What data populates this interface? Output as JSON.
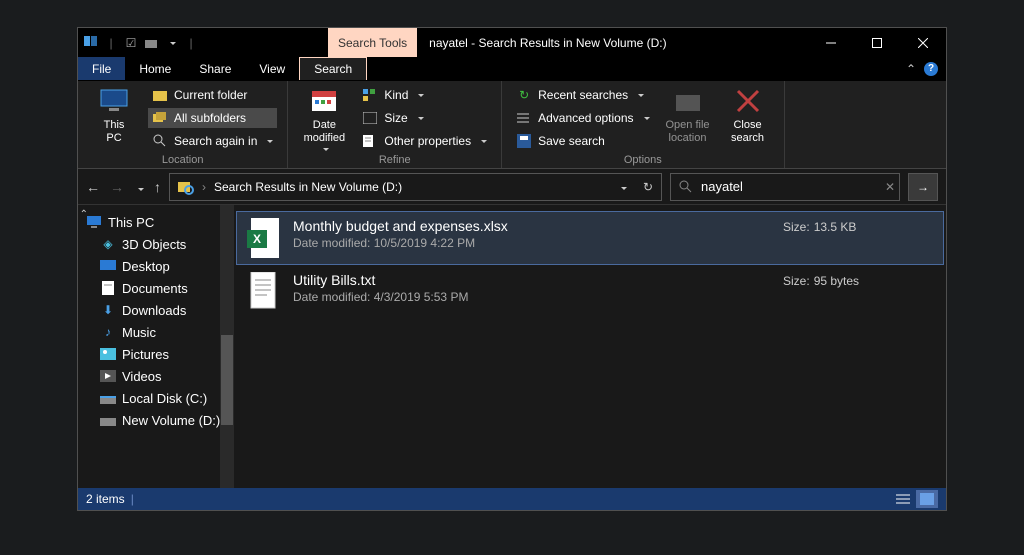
{
  "titlebar": {
    "tools_label": "Search Tools",
    "title": "nayatel - Search Results in New Volume (D:)"
  },
  "menu": {
    "file": "File",
    "home": "Home",
    "share": "Share",
    "view": "View",
    "search": "Search"
  },
  "ribbon": {
    "this_pc": "This\nPC",
    "current_folder": "Current folder",
    "all_subfolders": "All subfolders",
    "search_again_in": "Search again in",
    "location_label": "Location",
    "date_modified": "Date\nmodified",
    "kind": "Kind",
    "size": "Size",
    "other_properties": "Other properties",
    "refine_label": "Refine",
    "recent_searches": "Recent searches",
    "advanced_options": "Advanced options",
    "save_search": "Save search",
    "open_file_location": "Open file\nlocation",
    "close_search": "Close\nsearch",
    "options_label": "Options"
  },
  "breadcrumb": {
    "path": "Search Results in New Volume (D:)"
  },
  "search": {
    "value": "nayatel"
  },
  "sidebar": {
    "root": "This PC",
    "items": [
      {
        "label": "3D Objects"
      },
      {
        "label": "Desktop"
      },
      {
        "label": "Documents"
      },
      {
        "label": "Downloads"
      },
      {
        "label": "Music"
      },
      {
        "label": "Pictures"
      },
      {
        "label": "Videos"
      },
      {
        "label": "Local Disk (C:)"
      },
      {
        "label": "New Volume (D:)"
      }
    ]
  },
  "results": [
    {
      "name": "Monthly budget and expenses.xlsx",
      "modified": "Date modified: 10/5/2019 4:22 PM",
      "size_label": "Size:",
      "size": "13.5 KB",
      "type": "xlsx"
    },
    {
      "name": "Utility Bills.txt",
      "modified": "Date modified: 4/3/2019 5:53 PM",
      "size_label": "Size:",
      "size": "95 bytes",
      "type": "txt"
    }
  ],
  "status": {
    "count": "2 items"
  }
}
